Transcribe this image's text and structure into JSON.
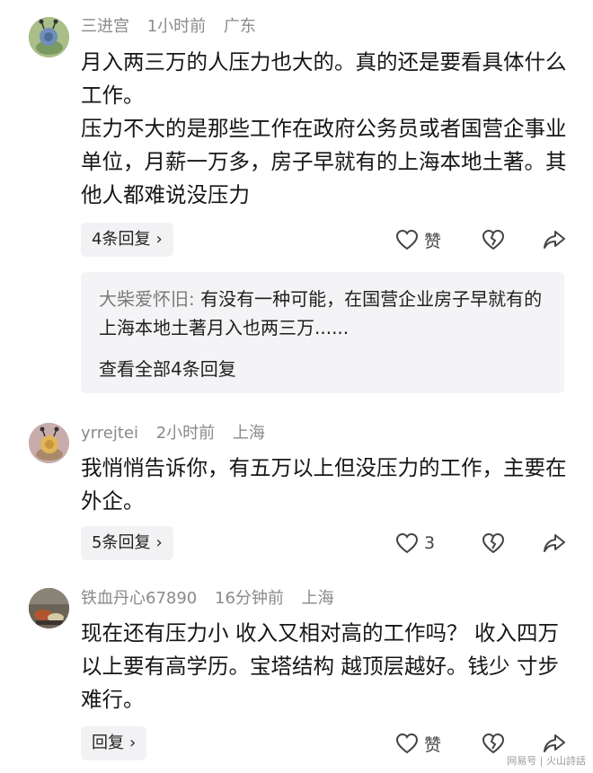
{
  "comments": [
    {
      "username": "三进宫",
      "time": "1小时前",
      "location": "广东",
      "paragraphs": [
        "月入两三万的人压力也大的。真的还是要看具体什么工作。",
        "压力不大的是那些工作在政府公务员或者国营企事业单位，月薪一万多，房子早就有的上海本地土著。其他人都难说没压力"
      ],
      "reply_label": "4条回复",
      "like_label": "赞",
      "avatar_icon": "snail-cartoon-avatar",
      "preview": {
        "user": "大柴爱怀旧",
        "separator": ":",
        "text": " 有没有一种可能，在国营企业房子早就有的上海本地土著月入也两三万......",
        "more_label": "查看全部4条回复"
      }
    },
    {
      "username": "yrrejtei",
      "time": "2小时前",
      "location": "上海",
      "paragraphs": [
        "我悄悄告诉你，有五万以上但没压力的工作，主要在外企。"
      ],
      "reply_label": "5条回复",
      "like_label": "3",
      "avatar_icon": "snail-cartoon-avatar"
    },
    {
      "username": "铁血丹心67890",
      "time": "16分钟前",
      "location": "上海",
      "paragraphs": [
        "现在还有压力小 收入又相对高的工作吗？ 收入四万以上要有高学历。宝塔结构 越顶层越好。钱少 寸步难行。"
      ],
      "reply_label": "回复",
      "like_label": "赞",
      "avatar_icon": "photo-avatar"
    }
  ],
  "icons": {
    "like": "heart-outline-icon",
    "dislike": "broken-heart-icon",
    "share": "share-arrow-icon",
    "chevron": "chevron-right-icon"
  },
  "watermark": "网易号 | 火山詩話",
  "colors": {
    "meta_gray": "#8a8a8a",
    "pill_bg": "#f2f2f4",
    "preview_bg": "#f4f4f6",
    "text": "#161616"
  }
}
